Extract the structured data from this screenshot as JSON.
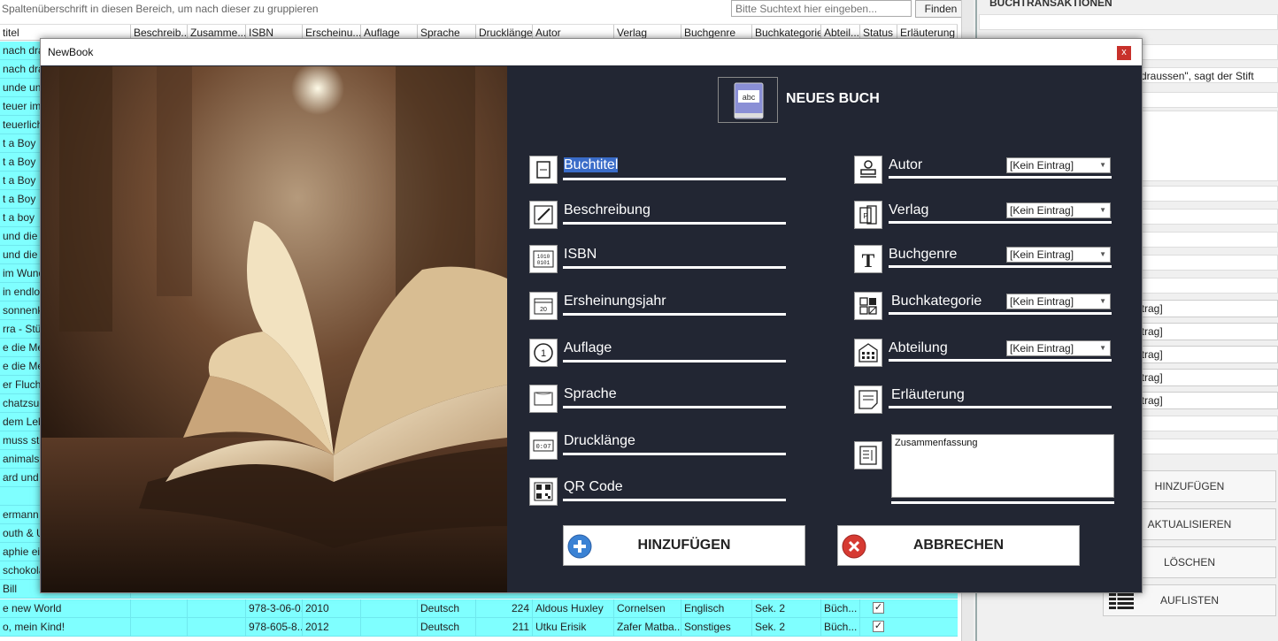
{
  "background": {
    "group_hint": "Spaltenüberschrift in diesen Bereich, um nach dieser zu gruppieren",
    "search_placeholder": "Bitte Suchtext hier eingeben...",
    "find_label": "Finden",
    "columns": [
      "titel",
      "Beschreib...",
      "Zusamme...",
      "ISBN",
      "Erscheinu...",
      "Auflage",
      "Sprache",
      "Drucklänge",
      "Autor",
      "Verlag",
      "Buchgenre",
      "Buchkategorie",
      "Abteil...",
      "Status",
      "Erläuterung"
    ],
    "title_fragments": [
      "nach draus",
      "nach draus",
      "unde und",
      "teuer im Z",
      "teuerliche",
      "t a Boy",
      "t a Boy",
      "t a Boy",
      "t a Boy",
      "t a boy",
      "und die",
      "und die",
      "im Wunde",
      "in endlos",
      "sonnenkla",
      "rra - Stück",
      "e die Meer",
      "e die Meer",
      "er Flucht",
      "chatzsuch",
      "dem Leben",
      "muss ster",
      "animals",
      "ard und Bi",
      "",
      "ermann un",
      "outh & Ug",
      "aphie eine",
      "schokolad",
      "Bill"
    ],
    "bottom_rows": [
      {
        "title": "e new World",
        "isbn": "978-3-06-0...",
        "year": "2010",
        "lang": "Deutsch",
        "pages": "224",
        "author": "Aldous Huxley",
        "publisher": "Cornelsen",
        "genre": "Englisch",
        "category": "Sek. 2",
        "dept": "Büch...",
        "check": "✓"
      },
      {
        "title": "o, mein Kind!",
        "isbn": "978-605-8...",
        "year": "2012",
        "lang": "Deutsch",
        "pages": "211",
        "author": "Utku Erisik",
        "publisher": "Zafer Matba...",
        "genre": "Sonstiges",
        "category": "Sek. 2",
        "dept": "Büch...",
        "check": "✓"
      }
    ]
  },
  "right_panel": {
    "title": "BUCHTRANSAKTIONEN",
    "text_field": "h draussen\", sagt der Stift",
    "list_items": [
      "ntrag]",
      "ntrag]",
      "ntrag]",
      "ntrag]",
      "ntrag]"
    ],
    "buttons": [
      "HINZUFÜGEN",
      "AKTUALISIEREN",
      "LÖSCHEN",
      "AUFLISTEN"
    ]
  },
  "dialog": {
    "window_title": "NewBook",
    "close": "x",
    "header": "NEUES BUCH",
    "left_fields": [
      "Buchtitel",
      "Beschreibung",
      "ISBN",
      "Ersheinungsjahr",
      "Auflage",
      "Sprache",
      "Drucklänge",
      "QR Code"
    ],
    "right_fields": [
      "Autor",
      "Verlag",
      "Buchgenre",
      "Buchkategorie",
      "Abteilung",
      "Erläuterung"
    ],
    "combo_value": "[Kein Eintrag]",
    "summary_text": "Zusammenfassung",
    "add_button": "HINZUFÜGEN",
    "cancel_button": "ABBRECHEN"
  },
  "colors": {
    "dialog_bg": "#222633",
    "grid_row": "#7fffff",
    "accent_blue": "#3b82d4",
    "accent_red": "#d63a32"
  }
}
